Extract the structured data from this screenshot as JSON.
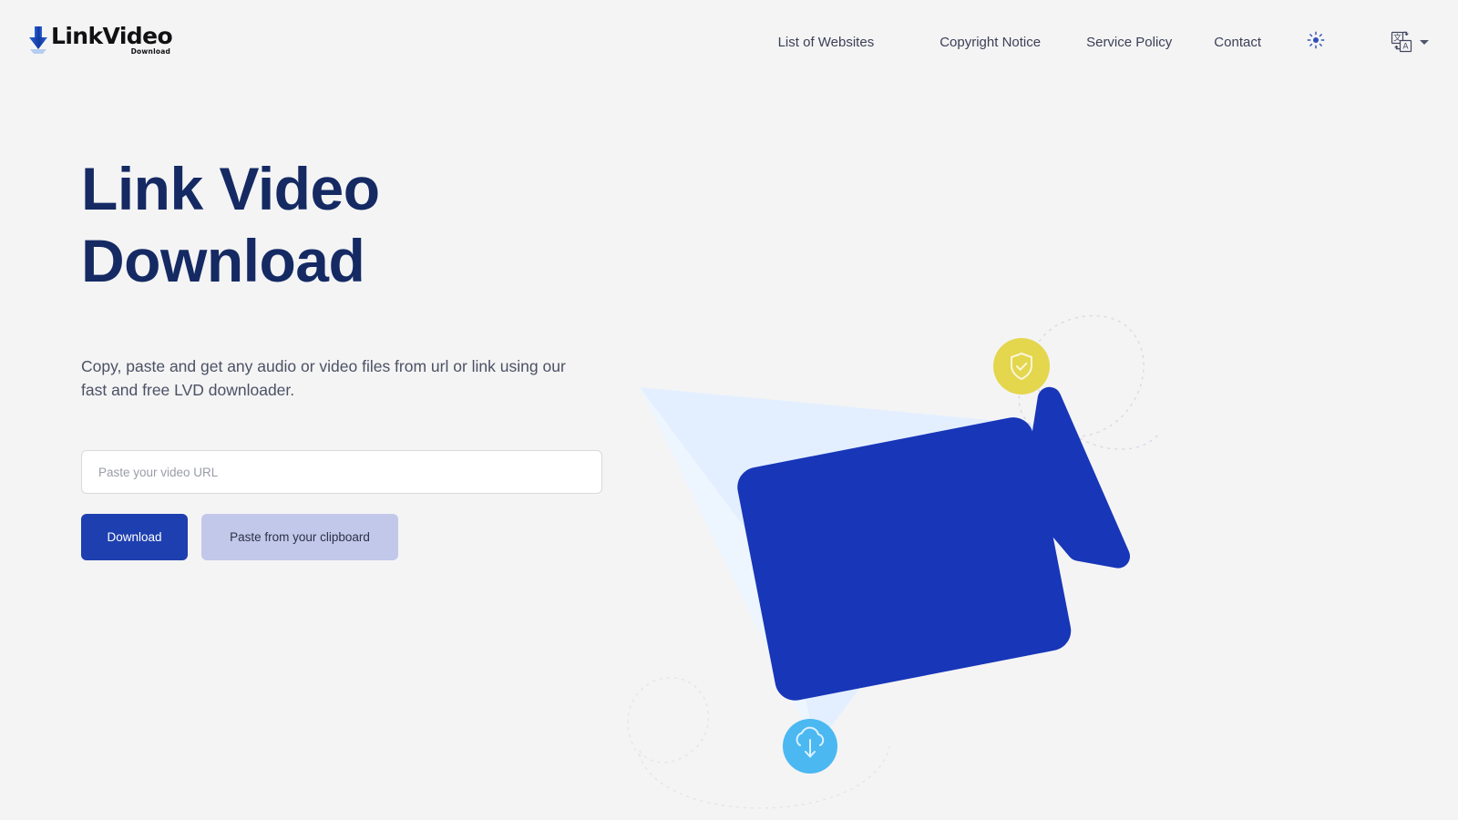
{
  "brand": {
    "logo_main": "LinkVideo",
    "logo_sub": "Download",
    "arrow_icon": "download-arrow-icon"
  },
  "header": {
    "nav": [
      {
        "label": "List of Websites"
      },
      {
        "label": "Copyright Notice"
      },
      {
        "label": "Service Policy"
      },
      {
        "label": "Contact"
      }
    ],
    "theme_toggle_icon": "sun-icon",
    "language_icon": "translate-icon",
    "language_caret_icon": "chevron-down-icon"
  },
  "hero": {
    "title_line1": "Link Video",
    "title_line2": "Download",
    "subtitle": "Copy, paste and get any audio or video files from url or link using our fast and free LVD downloader.",
    "input_placeholder": "Paste your video URL",
    "input_value": "",
    "download_label": "Download",
    "clipboard_label": "Paste from your clipboard"
  },
  "illustration": {
    "camera_icon": "video-camera-icon",
    "plane_icon": "paper-plane-shape",
    "shield_badge_icon": "shield-check-icon",
    "cloud_badge_icon": "cloud-download-icon",
    "dotted_path_icon": "dotted-curve-decoration"
  },
  "colors": {
    "page_background": "#f4f4f5",
    "brand_blue": "#1e3faf",
    "heading_navy": "#152a63",
    "clipboard_button": "#c2c8ea",
    "plane_light_blue": "#e1efff",
    "shield_badge_yellow": "#e6d64b",
    "cloud_badge_blue": "#4bb7f0",
    "nav_text": "#3b3f55",
    "body_text": "#4c5164"
  }
}
